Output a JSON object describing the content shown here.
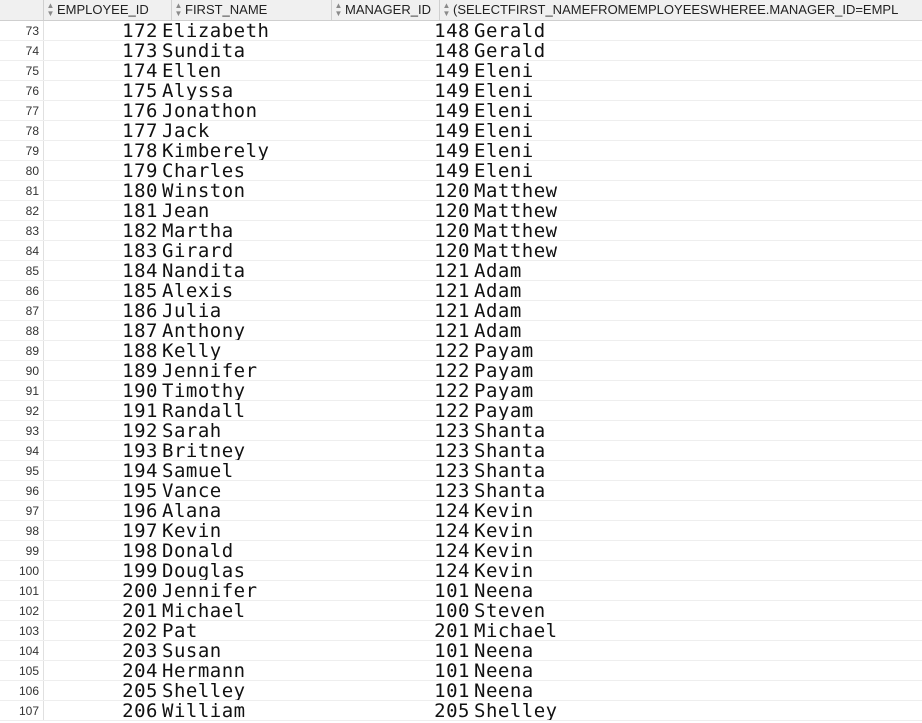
{
  "header": {
    "columns": [
      "EMPLOYEE_ID",
      "FIRST_NAME",
      "MANAGER_ID",
      "(SELECTFIRST_NAMEFROMEMPLOYEESWHEREE.MANAGER_ID=EMPL"
    ]
  },
  "rows": [
    {
      "rn": "73",
      "employee_id": "172",
      "first_name": "Elizabeth",
      "manager_id": "148",
      "manager_name": "Gerald"
    },
    {
      "rn": "74",
      "employee_id": "173",
      "first_name": "Sundita",
      "manager_id": "148",
      "manager_name": "Gerald"
    },
    {
      "rn": "75",
      "employee_id": "174",
      "first_name": "Ellen",
      "manager_id": "149",
      "manager_name": "Eleni"
    },
    {
      "rn": "76",
      "employee_id": "175",
      "first_name": "Alyssa",
      "manager_id": "149",
      "manager_name": "Eleni"
    },
    {
      "rn": "77",
      "employee_id": "176",
      "first_name": "Jonathon",
      "manager_id": "149",
      "manager_name": "Eleni"
    },
    {
      "rn": "78",
      "employee_id": "177",
      "first_name": "Jack",
      "manager_id": "149",
      "manager_name": "Eleni"
    },
    {
      "rn": "79",
      "employee_id": "178",
      "first_name": "Kimberely",
      "manager_id": "149",
      "manager_name": "Eleni"
    },
    {
      "rn": "80",
      "employee_id": "179",
      "first_name": "Charles",
      "manager_id": "149",
      "manager_name": "Eleni"
    },
    {
      "rn": "81",
      "employee_id": "180",
      "first_name": "Winston",
      "manager_id": "120",
      "manager_name": "Matthew"
    },
    {
      "rn": "82",
      "employee_id": "181",
      "first_name": "Jean",
      "manager_id": "120",
      "manager_name": "Matthew"
    },
    {
      "rn": "83",
      "employee_id": "182",
      "first_name": "Martha",
      "manager_id": "120",
      "manager_name": "Matthew"
    },
    {
      "rn": "84",
      "employee_id": "183",
      "first_name": "Girard",
      "manager_id": "120",
      "manager_name": "Matthew"
    },
    {
      "rn": "85",
      "employee_id": "184",
      "first_name": "Nandita",
      "manager_id": "121",
      "manager_name": "Adam"
    },
    {
      "rn": "86",
      "employee_id": "185",
      "first_name": "Alexis",
      "manager_id": "121",
      "manager_name": "Adam"
    },
    {
      "rn": "87",
      "employee_id": "186",
      "first_name": "Julia",
      "manager_id": "121",
      "manager_name": "Adam"
    },
    {
      "rn": "88",
      "employee_id": "187",
      "first_name": "Anthony",
      "manager_id": "121",
      "manager_name": "Adam"
    },
    {
      "rn": "89",
      "employee_id": "188",
      "first_name": "Kelly",
      "manager_id": "122",
      "manager_name": "Payam"
    },
    {
      "rn": "90",
      "employee_id": "189",
      "first_name": "Jennifer",
      "manager_id": "122",
      "manager_name": "Payam"
    },
    {
      "rn": "91",
      "employee_id": "190",
      "first_name": "Timothy",
      "manager_id": "122",
      "manager_name": "Payam"
    },
    {
      "rn": "92",
      "employee_id": "191",
      "first_name": "Randall",
      "manager_id": "122",
      "manager_name": "Payam"
    },
    {
      "rn": "93",
      "employee_id": "192",
      "first_name": "Sarah",
      "manager_id": "123",
      "manager_name": "Shanta"
    },
    {
      "rn": "94",
      "employee_id": "193",
      "first_name": "Britney",
      "manager_id": "123",
      "manager_name": "Shanta"
    },
    {
      "rn": "95",
      "employee_id": "194",
      "first_name": "Samuel",
      "manager_id": "123",
      "manager_name": "Shanta"
    },
    {
      "rn": "96",
      "employee_id": "195",
      "first_name": "Vance",
      "manager_id": "123",
      "manager_name": "Shanta"
    },
    {
      "rn": "97",
      "employee_id": "196",
      "first_name": "Alana",
      "manager_id": "124",
      "manager_name": "Kevin"
    },
    {
      "rn": "98",
      "employee_id": "197",
      "first_name": "Kevin",
      "manager_id": "124",
      "manager_name": "Kevin"
    },
    {
      "rn": "99",
      "employee_id": "198",
      "first_name": "Donald",
      "manager_id": "124",
      "manager_name": "Kevin"
    },
    {
      "rn": "100",
      "employee_id": "199",
      "first_name": "Douglas",
      "manager_id": "124",
      "manager_name": "Kevin"
    },
    {
      "rn": "101",
      "employee_id": "200",
      "first_name": "Jennifer",
      "manager_id": "101",
      "manager_name": "Neena"
    },
    {
      "rn": "102",
      "employee_id": "201",
      "first_name": "Michael",
      "manager_id": "100",
      "manager_name": "Steven"
    },
    {
      "rn": "103",
      "employee_id": "202",
      "first_name": "Pat",
      "manager_id": "201",
      "manager_name": "Michael"
    },
    {
      "rn": "104",
      "employee_id": "203",
      "first_name": "Susan",
      "manager_id": "101",
      "manager_name": "Neena"
    },
    {
      "rn": "105",
      "employee_id": "204",
      "first_name": "Hermann",
      "manager_id": "101",
      "manager_name": "Neena"
    },
    {
      "rn": "106",
      "employee_id": "205",
      "first_name": "Shelley",
      "manager_id": "101",
      "manager_name": "Neena"
    },
    {
      "rn": "107",
      "employee_id": "206",
      "first_name": "William",
      "manager_id": "205",
      "manager_name": "Shelley"
    }
  ],
  "icons": {
    "sort": "sort-icon"
  }
}
